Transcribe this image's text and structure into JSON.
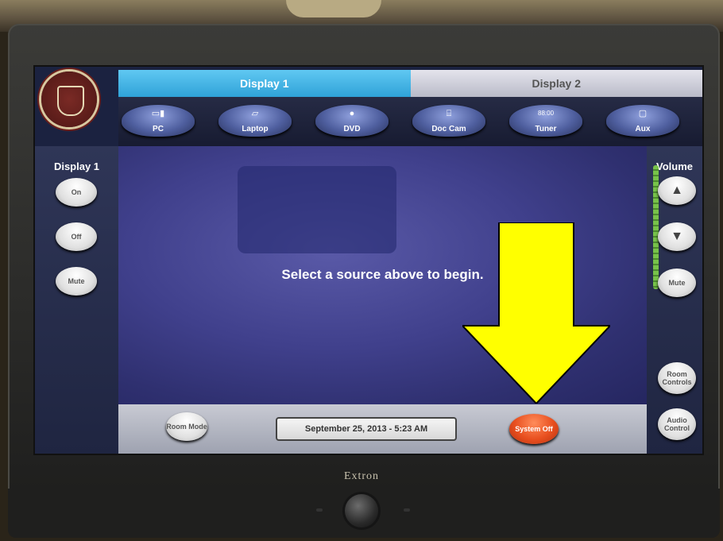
{
  "tabs": {
    "display1": "Display 1",
    "display2": "Display 2"
  },
  "sources": [
    {
      "label": "PC",
      "icon": "pc-icon"
    },
    {
      "label": "Laptop",
      "icon": "laptop-icon"
    },
    {
      "label": "DVD",
      "icon": "dvd-icon"
    },
    {
      "label": "Doc Cam",
      "icon": "doc-cam-icon"
    },
    {
      "label": "Tuner",
      "icon": "tuner-icon"
    },
    {
      "label": "Aux",
      "icon": "aux-icon"
    }
  ],
  "left_panel": {
    "title": "Display 1",
    "on": "On",
    "off": "Off",
    "mute": "Mute"
  },
  "right_panel": {
    "title": "Volume",
    "mute": "Mute",
    "room_controls": "Room Controls",
    "audio_control": "Audio Control"
  },
  "main": {
    "message": "Select a source above to begin."
  },
  "footer": {
    "room_mode": "Room Mode",
    "datetime": "September 25, 2013  -  5:23 AM",
    "system_off": "System Off"
  },
  "tuner_glyph": "88:00",
  "brand": "Extron",
  "colors": {
    "active_tab": "#2fa2d8",
    "system_off": "#e84f1f",
    "arrow": "#ffff00"
  }
}
